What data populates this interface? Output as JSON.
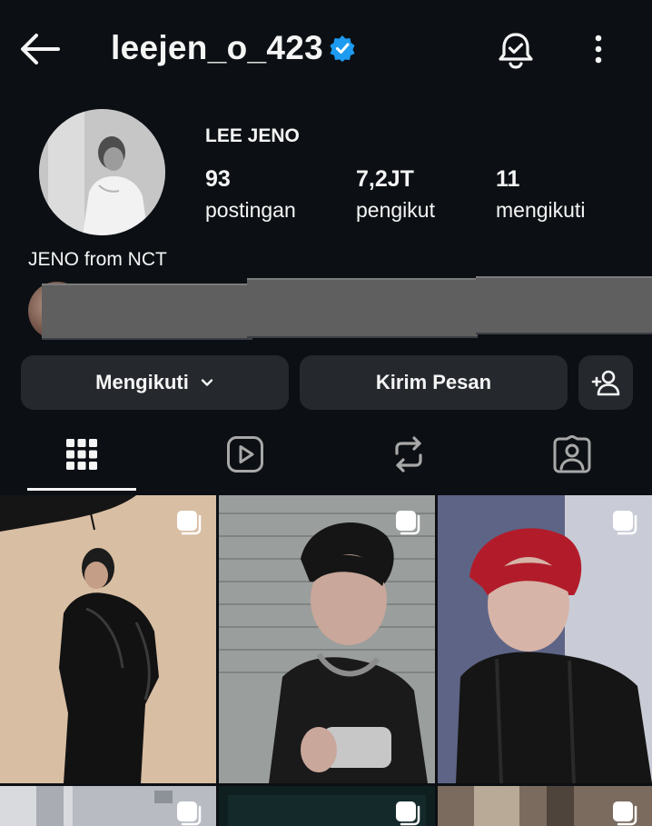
{
  "header": {
    "username": "leejen_o_423",
    "back_icon": "arrow-left-icon",
    "verified_icon": "verified-badge-icon",
    "notification_icon": "bell-check-icon",
    "more_icon": "more-vertical-icon",
    "verified_color": "#1d9bf0"
  },
  "profile": {
    "display_name": "LEE JENO",
    "bio": "JENO from NCT",
    "stats": [
      {
        "value": "93",
        "label": "postingan"
      },
      {
        "value": "7,2JT",
        "label": "pengikut"
      },
      {
        "value": "11",
        "label": "mengikuti"
      }
    ]
  },
  "actions": {
    "following_label": "Mengikuti",
    "message_label": "Kirim Pesan",
    "add_user_icon": "add-person-icon"
  },
  "tabs": [
    {
      "icon": "grid-icon",
      "active": true
    },
    {
      "icon": "reels-icon",
      "active": false
    },
    {
      "icon": "repost-icon",
      "active": false
    },
    {
      "icon": "tagged-icon",
      "active": false
    }
  ],
  "posts": [
    {
      "description": "man in black leather coat with umbrella",
      "multi": true
    },
    {
      "description": "man holding phone in black tank top",
      "multi": true
    },
    {
      "description": "man with red hair in black top",
      "multi": true
    },
    {
      "description": "building",
      "multi": true
    },
    {
      "description": "dark photo",
      "multi": true
    },
    {
      "description": "indoor photo",
      "multi": true
    }
  ]
}
